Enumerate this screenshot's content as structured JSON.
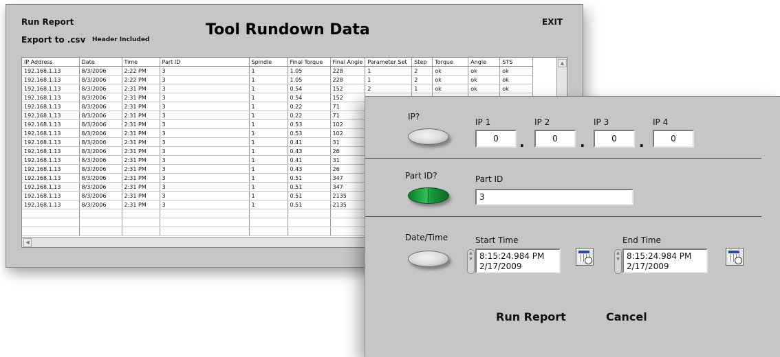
{
  "main": {
    "run_report": "Run Report",
    "export_csv": "Export to .csv",
    "header_included": "Header Included",
    "title": "Tool Rundown Data",
    "exit": "EXIT"
  },
  "table": {
    "columns": [
      "IP Address",
      "Date",
      "Time",
      "Part ID",
      "Spindle",
      "Final Torque",
      "Final Angle",
      "Parameter Set",
      "Step",
      "Torque",
      "Angle",
      "STS"
    ],
    "rows": [
      [
        "192.168.1.13",
        "8/3/2006",
        "2:22 PM",
        "3",
        "1",
        "1.05",
        "228",
        "1",
        "2",
        "ok",
        "ok",
        "ok"
      ],
      [
        "192.168.1.13",
        "8/3/2006",
        "2:22 PM",
        "3",
        "1",
        "1.05",
        "228",
        "1",
        "2",
        "ok",
        "ok",
        "ok"
      ],
      [
        "192.168.1.13",
        "8/3/2006",
        "2:31 PM",
        "3",
        "1",
        "0.54",
        "152",
        "2",
        "1",
        "ok",
        "ok",
        "ok"
      ],
      [
        "192.168.1.13",
        "8/3/2006",
        "2:31 PM",
        "3",
        "1",
        "0.54",
        "152",
        "",
        "",
        "",
        "",
        ""
      ],
      [
        "192.168.1.13",
        "8/3/2006",
        "2:31 PM",
        "3",
        "1",
        "0.22",
        "71",
        "",
        "",
        "",
        "",
        ""
      ],
      [
        "192.168.1.13",
        "8/3/2006",
        "2:31 PM",
        "3",
        "1",
        "0.22",
        "71",
        "",
        "",
        "",
        "",
        ""
      ],
      [
        "192.168.1.13",
        "8/3/2006",
        "2:31 PM",
        "3",
        "1",
        "0.53",
        "102",
        "",
        "",
        "",
        "",
        ""
      ],
      [
        "192.168.1.13",
        "8/3/2006",
        "2:31 PM",
        "3",
        "1",
        "0.53",
        "102",
        "",
        "",
        "",
        "",
        ""
      ],
      [
        "192.168.1.13",
        "8/3/2006",
        "2:31 PM",
        "3",
        "1",
        "0.41",
        "31",
        "",
        "",
        "",
        "",
        ""
      ],
      [
        "192.168.1.13",
        "8/3/2006",
        "2:31 PM",
        "3",
        "1",
        "0.43",
        "26",
        "",
        "",
        "",
        "",
        ""
      ],
      [
        "192.168.1.13",
        "8/3/2006",
        "2:31 PM",
        "3",
        "1",
        "0.41",
        "31",
        "",
        "",
        "",
        "",
        ""
      ],
      [
        "192.168.1.13",
        "8/3/2006",
        "2:31 PM",
        "3",
        "1",
        "0.43",
        "26",
        "",
        "",
        "",
        "",
        ""
      ],
      [
        "192.168.1.13",
        "8/3/2006",
        "2:31 PM",
        "3",
        "1",
        "0.51",
        "347",
        "",
        "",
        "",
        "",
        ""
      ],
      [
        "192.168.1.13",
        "8/3/2006",
        "2:31 PM",
        "3",
        "1",
        "0.51",
        "347",
        "",
        "",
        "",
        "",
        ""
      ],
      [
        "192.168.1.13",
        "8/3/2006",
        "2:31 PM",
        "3",
        "1",
        "0.51",
        "2135",
        "",
        "",
        "",
        "",
        ""
      ],
      [
        "192.168.1.13",
        "8/3/2006",
        "2:31 PM",
        "3",
        "1",
        "0.51",
        "2135",
        "",
        "",
        "",
        "",
        ""
      ],
      [
        "",
        "",
        "",
        "",
        "",
        "",
        "",
        "",
        "",
        "",
        "",
        ""
      ],
      [
        "",
        "",
        "",
        "",
        "",
        "",
        "",
        "",
        "",
        "",
        "",
        ""
      ],
      [
        "",
        "",
        "",
        "",
        "",
        "",
        "",
        "",
        "",
        "",
        "",
        ""
      ]
    ]
  },
  "dialog": {
    "ip_label": "IP?",
    "ip_toggle_on": false,
    "ip_fields": [
      {
        "label": "IP 1",
        "value": "0"
      },
      {
        "label": "IP 2",
        "value": "0"
      },
      {
        "label": "IP 3",
        "value": "0"
      },
      {
        "label": "IP 4",
        "value": "0"
      }
    ],
    "ip_separator": ".",
    "partid_label": "Part ID?",
    "partid_toggle_on": true,
    "partid_field_label": "Part ID",
    "partid_value": "3",
    "datetime_label": "Date/Time",
    "datetime_toggle_on": false,
    "start_time_label": "Start Time",
    "start_time_line1": "8:15:24.984 PM",
    "start_time_line2": "2/17/2009",
    "end_time_label": "End Time",
    "end_time_line1": "8:15:24.984 PM",
    "end_time_line2": "2/17/2009",
    "run_report_button": "Run Report",
    "cancel_button": "Cancel"
  },
  "icons": {
    "calendar": "calendar-clock-icon",
    "scroll_up": "scroll-up-arrow-icon",
    "scroll_left": "scroll-left-arrow-icon",
    "spinner": "spinner-arrows-icon"
  },
  "colors": {
    "panel_bg": "#c6c6c6",
    "toggle_on": "#1a9a3c"
  }
}
